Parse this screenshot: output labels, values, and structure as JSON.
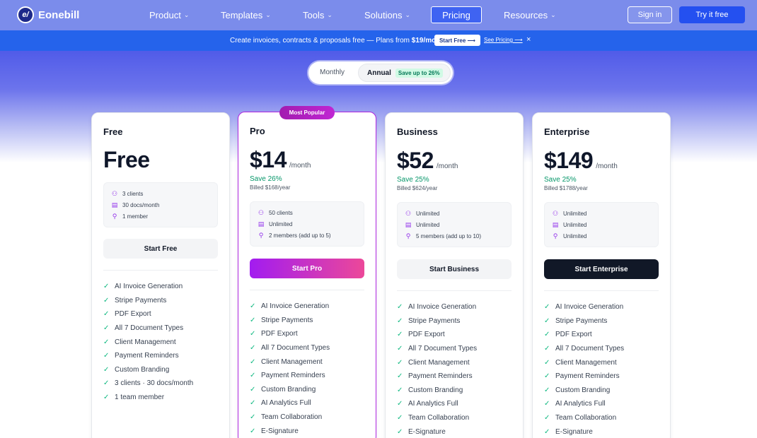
{
  "brand": {
    "name": "Eonebill",
    "logo_mark": "e/"
  },
  "nav": {
    "items": [
      {
        "label": "Product"
      },
      {
        "label": "Templates"
      },
      {
        "label": "Tools"
      },
      {
        "label": "Solutions"
      }
    ],
    "pricing": "Pricing",
    "resources": "Resources",
    "sign_in": "Sign in",
    "try_free": "Try it free"
  },
  "banner": {
    "text_prefix": "Create invoices, contracts & proposals free — Plans from ",
    "price": "$19/mo",
    "start_free": "Start Free ⟶",
    "see_pricing": "See Pricing ⟶",
    "close": "×"
  },
  "billing_toggle": {
    "monthly": "Monthly",
    "annual": "Annual",
    "annual_badge": "Save up to 26%",
    "selected": "Annual"
  },
  "plans": [
    {
      "name": "Free",
      "price": "Free",
      "per": "",
      "save": "",
      "billed": "",
      "limits": [
        {
          "icon": "users-icon",
          "text": "3 clients"
        },
        {
          "icon": "document-icon",
          "text": "30 docs/month"
        },
        {
          "icon": "user-add-icon",
          "text": "1 member"
        }
      ],
      "cta": "Start Free",
      "features": [
        "AI Invoice Generation",
        "Stripe Payments",
        "PDF Export",
        "All 7 Document Types",
        "Client Management",
        "Payment Reminders",
        "Custom Branding",
        "3 clients · 30 docs/month",
        "1 team member"
      ]
    },
    {
      "name": "Pro",
      "badge": "Most Popular",
      "price": "$14",
      "per": "/month",
      "save": "Save 26%",
      "billed": "Billed $168/year",
      "limits": [
        {
          "icon": "users-icon",
          "text": "50 clients"
        },
        {
          "icon": "document-icon",
          "text": "Unlimited"
        },
        {
          "icon": "user-add-icon",
          "text": "2 members (add up to 5)"
        }
      ],
      "cta": "Start Pro",
      "features": [
        "AI Invoice Generation",
        "Stripe Payments",
        "PDF Export",
        "All 7 Document Types",
        "Client Management",
        "Payment Reminders",
        "Custom Branding",
        "AI Analytics Full",
        "Team Collaboration",
        "E-Signature"
      ]
    },
    {
      "name": "Business",
      "price": "$52",
      "per": "/month",
      "save": "Save 25%",
      "billed": "Billed $624/year",
      "limits": [
        {
          "icon": "users-icon",
          "text": "Unlimited"
        },
        {
          "icon": "document-icon",
          "text": "Unlimited"
        },
        {
          "icon": "user-add-icon",
          "text": "5 members (add up to 10)"
        }
      ],
      "cta": "Start Business",
      "features": [
        "AI Invoice Generation",
        "Stripe Payments",
        "PDF Export",
        "All 7 Document Types",
        "Client Management",
        "Payment Reminders",
        "Custom Branding",
        "AI Analytics Full",
        "Team Collaboration",
        "E-Signature"
      ]
    },
    {
      "name": "Enterprise",
      "price": "$149",
      "per": "/month",
      "save": "Save 25%",
      "billed": "Billed $1788/year",
      "limits": [
        {
          "icon": "users-icon",
          "text": "Unlimited"
        },
        {
          "icon": "document-icon",
          "text": "Unlimited"
        },
        {
          "icon": "user-add-icon",
          "text": "Unlimited"
        }
      ],
      "cta": "Start Enterprise",
      "features": [
        "AI Invoice Generation",
        "Stripe Payments",
        "PDF Export",
        "All 7 Document Types",
        "Client Management",
        "Payment Reminders",
        "Custom Branding",
        "AI Analytics Full",
        "Team Collaboration",
        "E-Signature"
      ]
    }
  ],
  "colors": {
    "brand_blue": "#2563eb",
    "accent_purple": "#b026e0",
    "save_green": "#059669",
    "check_green": "#10b981",
    "dark_cta": "#111827"
  }
}
